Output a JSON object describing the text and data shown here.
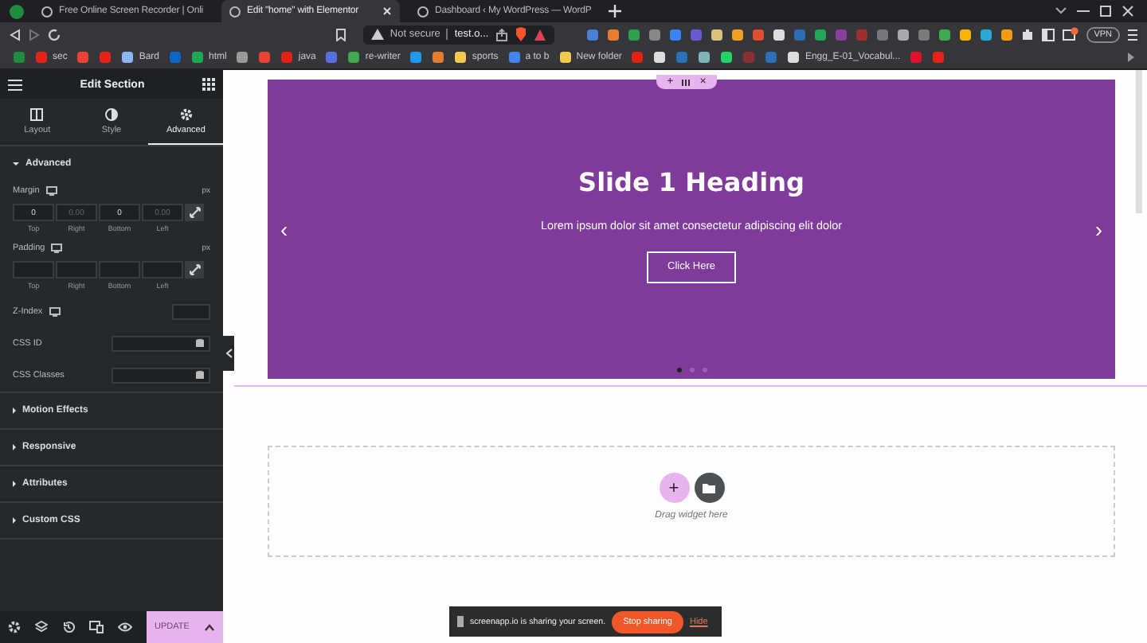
{
  "browser": {
    "tabs": [
      {
        "title": "Free Online Screen Recorder | Onli",
        "selected": false
      },
      {
        "title": "Edit \"home\" with Elementor",
        "selected": true
      },
      {
        "title": "Dashboard ‹ My WordPress — WordP",
        "selected": false
      }
    ],
    "address": {
      "security": "Not secure",
      "url": "test.o..."
    },
    "vpn": "VPN",
    "bookmarks": [
      {
        "label": "sec"
      },
      {
        "label": "Bard"
      },
      {
        "label": "html"
      },
      {
        "label": "java"
      },
      {
        "label": "re-writer"
      },
      {
        "label": "sports"
      },
      {
        "label": "a to b"
      },
      {
        "label": "New folder"
      },
      {
        "label": "Engg_E-01_Vocabul..."
      }
    ]
  },
  "panel": {
    "title": "Edit Section",
    "tabs": [
      {
        "label": "Layout",
        "selected": false
      },
      {
        "label": "Style",
        "selected": false
      },
      {
        "label": "Advanced",
        "selected": true
      }
    ],
    "section": {
      "title": "Advanced",
      "expanded": true
    },
    "margin": {
      "label": "Margin",
      "unit": "px",
      "fields": [
        {
          "label": "Top",
          "value": "0"
        },
        {
          "label": "Right",
          "placeholder": "0.00"
        },
        {
          "label": "Bottom",
          "value": "0"
        },
        {
          "label": "Left",
          "placeholder": "0.00"
        }
      ]
    },
    "padding": {
      "label": "Padding",
      "unit": "px",
      "fields": [
        {
          "label": "Top"
        },
        {
          "label": "Right"
        },
        {
          "label": "Bottom"
        },
        {
          "label": "Left"
        }
      ]
    },
    "z_index": {
      "label": "Z-Index"
    },
    "css_id": {
      "label": "CSS ID"
    },
    "css_classes": {
      "label": "CSS Classes"
    },
    "collapsed_sections": [
      {
        "title": "Motion Effects",
        "expanded": false
      },
      {
        "title": "Responsive",
        "expanded": false
      },
      {
        "title": "Attributes",
        "expanded": false
      },
      {
        "title": "Custom CSS",
        "expanded": false
      }
    ],
    "update_button": "UPDATE"
  },
  "canvas": {
    "handle": {
      "add": "+",
      "close": "×"
    },
    "slide": {
      "heading": "Slide 1 Heading",
      "text": "Lorem ipsum dolor sit amet consectetur adipiscing elit dolor",
      "button": "Click Here",
      "prev": "‹",
      "next": "›",
      "dots": [
        {
          "selected": true
        },
        {
          "selected": false
        },
        {
          "selected": false
        }
      ]
    },
    "empty_section": {
      "add": "+",
      "hint": "Drag widget here"
    }
  },
  "share_bar": {
    "message": "screenapp.io is sharing your screen.",
    "stop": "Stop sharing",
    "hide": "Hide"
  }
}
